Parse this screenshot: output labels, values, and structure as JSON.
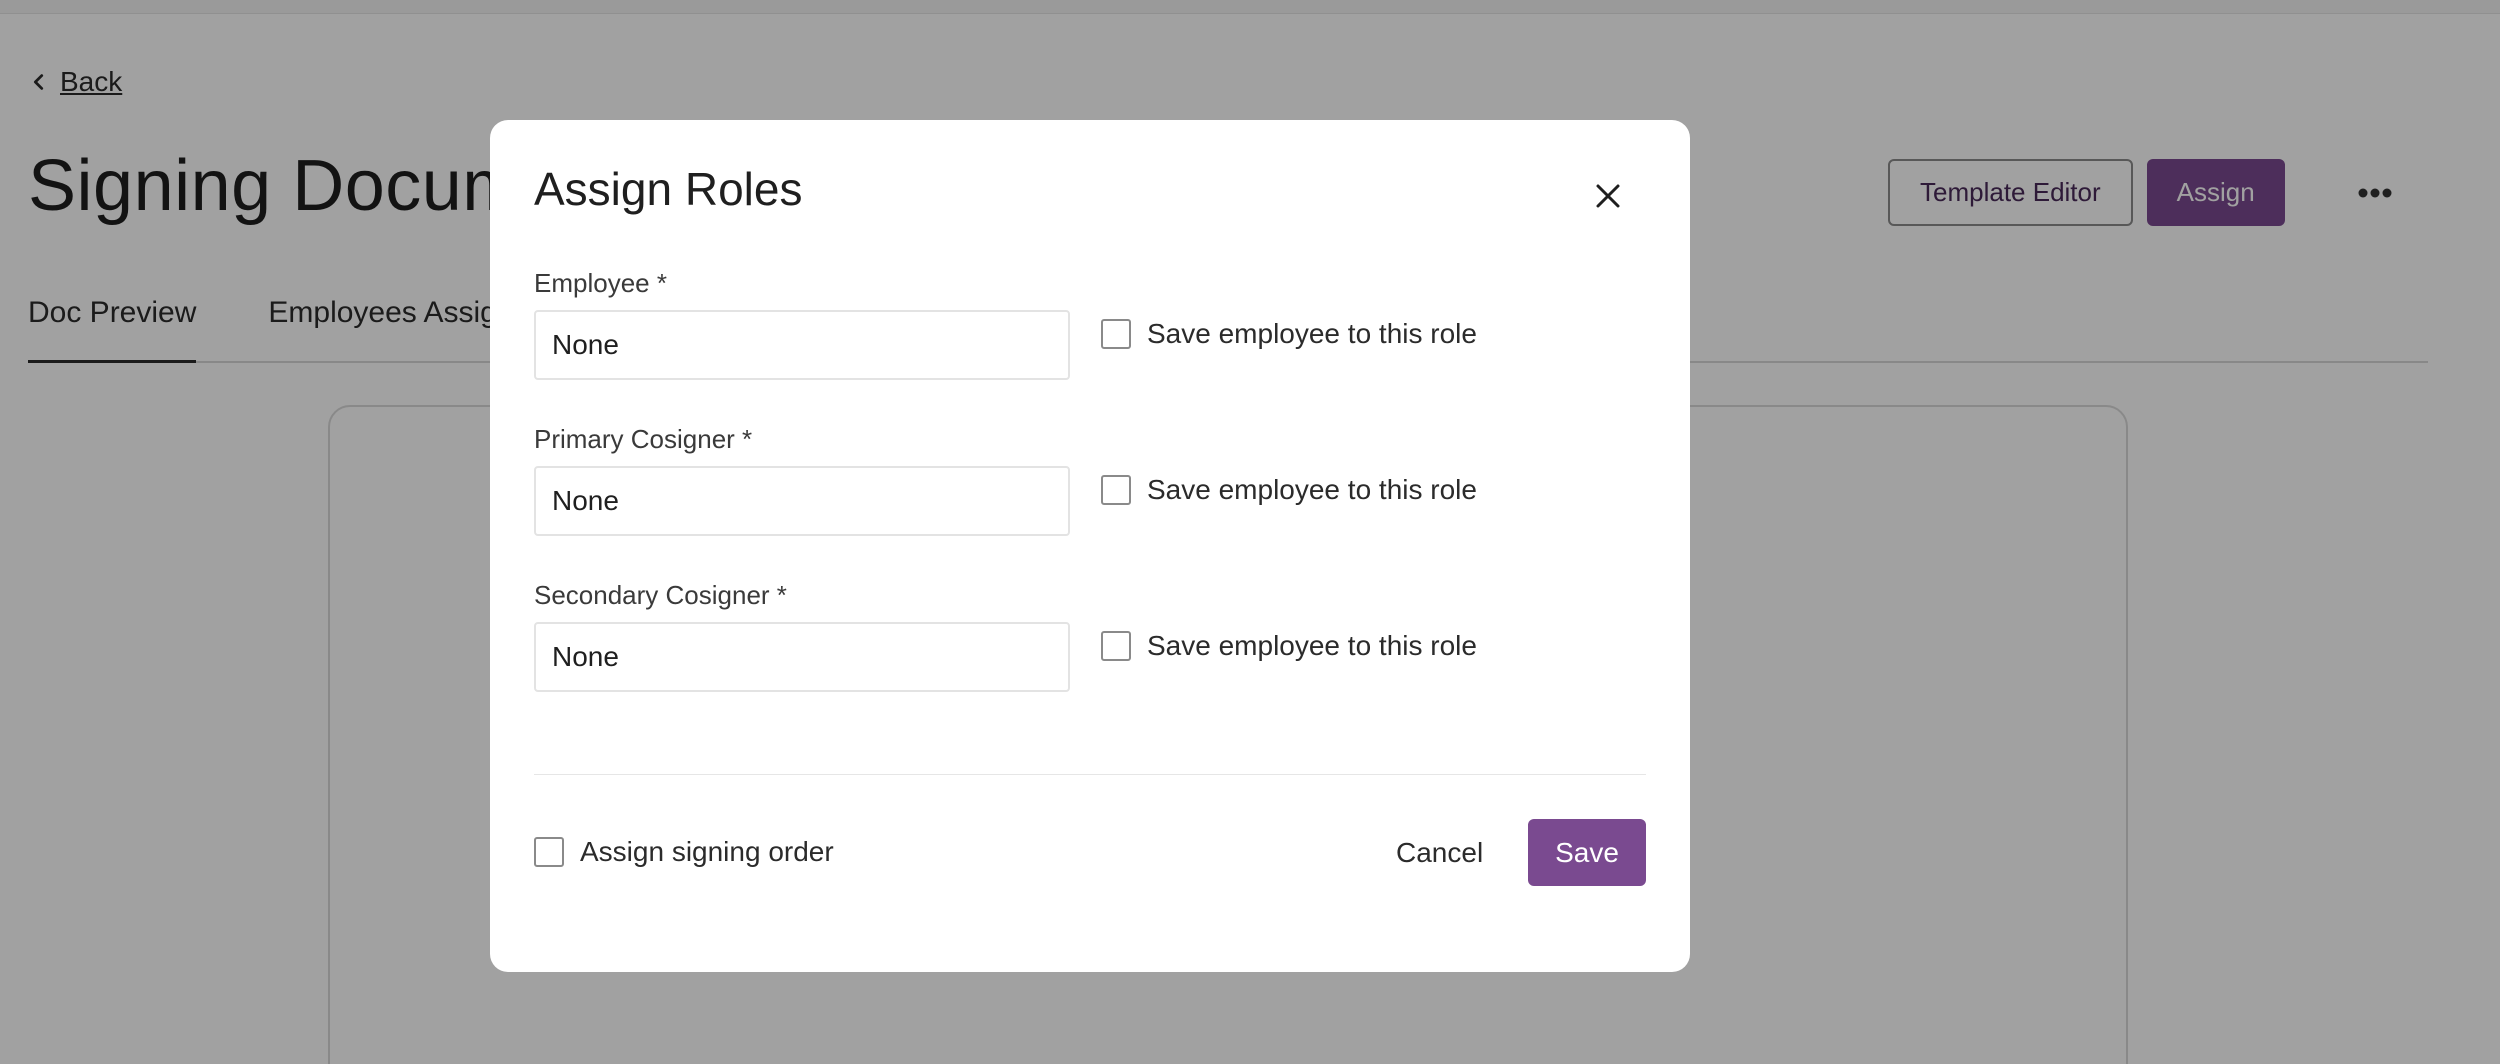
{
  "header": {
    "back_label": "Back",
    "page_title": "Signing Document",
    "template_editor_label": "Template Editor",
    "assign_label": "Assign"
  },
  "tabs": [
    {
      "label": "Doc Preview",
      "active": true
    },
    {
      "label": "Employees Assigned",
      "active": false
    }
  ],
  "modal": {
    "title": "Assign Roles",
    "roles": [
      {
        "label": "Employee *",
        "value": "None",
        "save_label": "Save employee to this role",
        "checked": false
      },
      {
        "label": "Primary Cosigner *",
        "value": "None",
        "save_label": "Save employee to this role",
        "checked": false
      },
      {
        "label": "Secondary Cosigner *",
        "value": "None",
        "save_label": "Save employee to this role",
        "checked": false
      }
    ],
    "signing_order_label": "Assign signing order",
    "cancel_label": "Cancel",
    "save_label": "Save"
  },
  "colors": {
    "accent": "#7a4a90",
    "overlay": "rgba(0,0,0,0.37)"
  },
  "icons": [
    "chevron-left-icon",
    "more-horizontal-icon",
    "close-icon"
  ]
}
